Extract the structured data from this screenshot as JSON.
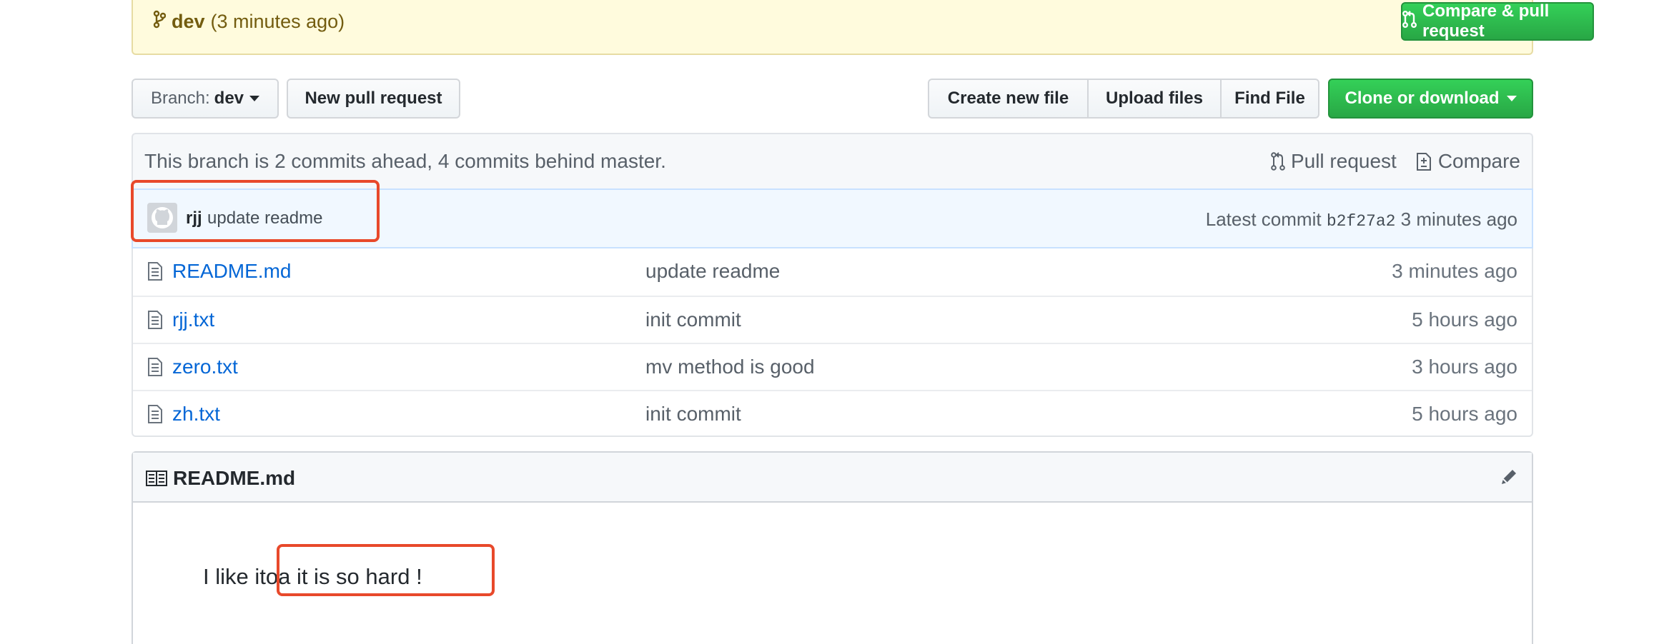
{
  "banner": {
    "branch": "dev",
    "time": "(3 minutes ago)",
    "compare_button": "Compare & pull request"
  },
  "toolbar": {
    "branch_prefix": "Branch:",
    "branch_name": "dev",
    "new_pr": "New pull request",
    "create_file": "Create new file",
    "upload_files": "Upload files",
    "find_file": "Find File",
    "clone": "Clone or download"
  },
  "branch_info": {
    "text": "This branch is 2 commits ahead, 4 commits behind master.",
    "pull_request": "Pull request",
    "compare": "Compare"
  },
  "latest_commit": {
    "author": "rjj",
    "message": "update readme",
    "label": "Latest commit",
    "sha": "b2f27a2",
    "time": "3 minutes ago"
  },
  "files": [
    {
      "name": "README.md",
      "message": "update readme",
      "age": "3 minutes ago"
    },
    {
      "name": "rjj.txt",
      "message": "init commit",
      "age": "5 hours ago"
    },
    {
      "name": "zero.txt",
      "message": "mv method is good",
      "age": "3 hours ago"
    },
    {
      "name": "zh.txt",
      "message": "init commit",
      "age": "5 hours ago"
    }
  ],
  "readme": {
    "title": "README.md",
    "content": "I like itoa it is so hard !"
  },
  "colors": {
    "link": "#0366d6",
    "green": "#28a745",
    "annotation": "#e8492b",
    "banner_bg": "#fffbdd"
  }
}
